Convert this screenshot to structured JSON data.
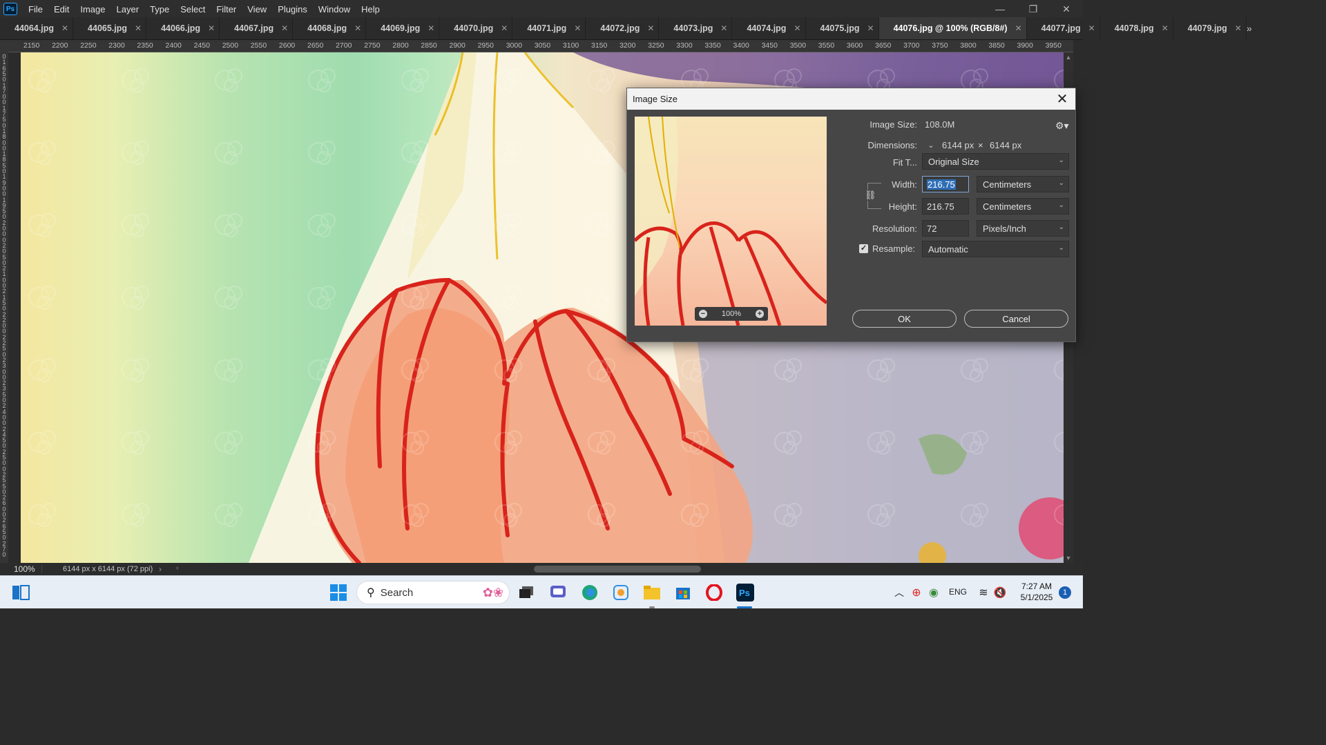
{
  "app": {
    "logo_text": "Ps",
    "menu": [
      "File",
      "Edit",
      "Image",
      "Layer",
      "Type",
      "Select",
      "Filter",
      "View",
      "Plugins",
      "Window",
      "Help"
    ],
    "window_controls": {
      "minimize": "—",
      "restore": "❐",
      "close": "✕"
    }
  },
  "tabs": [
    {
      "label": "44064.jpg",
      "active": false
    },
    {
      "label": "44065.jpg",
      "active": false
    },
    {
      "label": "44066.jpg",
      "active": false
    },
    {
      "label": "44067.jpg",
      "active": false
    },
    {
      "label": "44068.jpg",
      "active": false
    },
    {
      "label": "44069.jpg",
      "active": false
    },
    {
      "label": "44070.jpg",
      "active": false
    },
    {
      "label": "44071.jpg",
      "active": false
    },
    {
      "label": "44072.jpg",
      "active": false
    },
    {
      "label": "44073.jpg",
      "active": false
    },
    {
      "label": "44074.jpg",
      "active": false
    },
    {
      "label": "44075.jpg",
      "active": false
    },
    {
      "label": "44076.jpg @ 100% (RGB/8#)",
      "active": true
    },
    {
      "label": "44077.jpg",
      "active": false
    },
    {
      "label": "44078.jpg",
      "active": false
    },
    {
      "label": "44079.jpg",
      "active": false
    }
  ],
  "tab_close_glyph": "✕",
  "tab_overflow_glyph": "»",
  "ruler_top": [
    "2150",
    "2200",
    "2250",
    "2300",
    "2350",
    "2400",
    "2450",
    "2500",
    "2550",
    "2600",
    "2650",
    "2700",
    "2750",
    "2800",
    "2850",
    "2900",
    "2950",
    "3000",
    "3050",
    "3100",
    "3150",
    "3200",
    "3250",
    "3300",
    "3350",
    "3400",
    "3450",
    "3500",
    "3550",
    "3600",
    "3650",
    "3700",
    "3750",
    "3800",
    "3850",
    "3900",
    "3950"
  ],
  "ruler_left_digits": [
    "0",
    "1",
    "6",
    "5",
    "0",
    "1",
    "7",
    "0",
    "0",
    "1",
    "7",
    "5",
    "0",
    "1",
    "8",
    "0",
    "0",
    "1",
    "8",
    "5",
    "0",
    "1",
    "9",
    "0",
    "0",
    "1",
    "9",
    "5",
    "0",
    "2",
    "0",
    "0",
    "0",
    "2",
    "0",
    "5",
    "0",
    "2",
    "1",
    "0",
    "0",
    "2",
    "1",
    "5",
    "0",
    "2",
    "2",
    "0",
    "0",
    "2",
    "2",
    "5",
    "0",
    "2",
    "3",
    "0",
    "0",
    "2",
    "3",
    "5",
    "0",
    "2",
    "4",
    "0",
    "0",
    "2",
    "4",
    "5",
    "0",
    "2",
    "5",
    "0",
    "0",
    "2",
    "5",
    "5",
    "0",
    "2",
    "6",
    "0",
    "0",
    "2",
    "6",
    "5",
    "0",
    "2",
    "7",
    "0"
  ],
  "status": {
    "zoom": "100%",
    "doc_info": "6144 px x 6144 px (72 ppi)",
    "arrow": "›"
  },
  "dialog": {
    "title": "Image Size",
    "close_glyph": "✕",
    "preview_zoom": "100%",
    "image_size_label": "Image Size:",
    "image_size_value": "108.0M",
    "dimensions_label": "Dimensions:",
    "dim_width": "6144 px",
    "dim_times": "×",
    "dim_height": "6144 px",
    "fit_label": "Fit T...",
    "fit_value": "Original Size",
    "width_label": "Width:",
    "width_value": "216.75",
    "width_unit": "Centimeters",
    "height_label": "Height:",
    "height_value": "216.75",
    "height_unit": "Centimeters",
    "resolution_label": "Resolution:",
    "resolution_value": "72",
    "resolution_unit": "Pixels/Inch",
    "resample_label": "Resample:",
    "resample_checked": true,
    "resample_value": "Automatic",
    "ok": "OK",
    "cancel": "Cancel"
  },
  "taskbar": {
    "search_placeholder": "Search",
    "lang": "ENG",
    "time": "7:27 AM",
    "date": "5/1/2025",
    "notifications": "1"
  },
  "colors": {
    "ps_blue": "#31a8ff",
    "accent_selection": "#2f6fb7",
    "petal_red": "#d8231b"
  }
}
